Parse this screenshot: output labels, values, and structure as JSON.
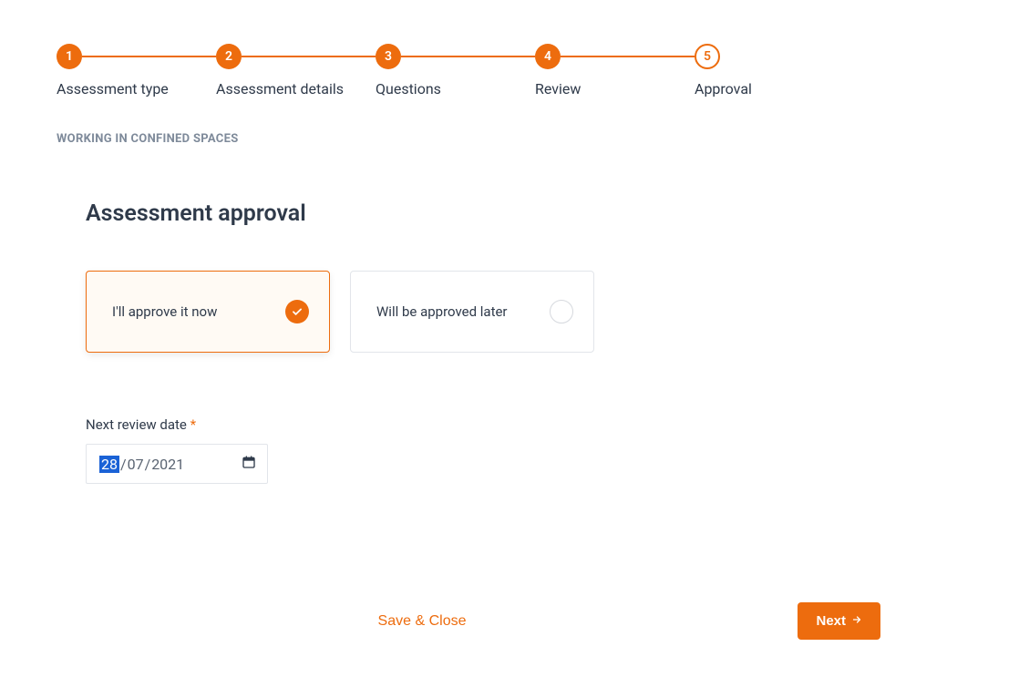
{
  "stepper": {
    "steps": [
      {
        "num": "1",
        "label": "Assessment type",
        "state": "done"
      },
      {
        "num": "2",
        "label": "Assessment details",
        "state": "done"
      },
      {
        "num": "3",
        "label": "Questions",
        "state": "done"
      },
      {
        "num": "4",
        "label": "Review",
        "state": "done"
      },
      {
        "num": "5",
        "label": "Approval",
        "state": "current"
      }
    ]
  },
  "context_title": "WORKING IN CONFINED SPACES",
  "page_heading": "Assessment approval",
  "approval_options": {
    "approve_now": {
      "label": "I'll approve it now",
      "selected": true
    },
    "approve_later": {
      "label": "Will be approved later",
      "selected": false
    }
  },
  "review_date": {
    "label": "Next review date",
    "required_marker": "*",
    "day": "28",
    "month": "07",
    "year": "2021",
    "highlighted_segment": "day"
  },
  "actions": {
    "save_close": "Save & Close",
    "next": "Next"
  }
}
